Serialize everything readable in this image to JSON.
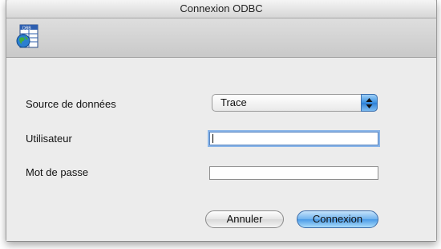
{
  "window": {
    "title": "Connexion ODBC"
  },
  "toolbar": {
    "icon": "database-globe-icon"
  },
  "form": {
    "source_label": "Source de données",
    "source_value": "Trace",
    "user_label": "Utilisateur",
    "user_value": "",
    "password_label": "Mot de passe",
    "password_value": ""
  },
  "buttons": {
    "cancel_label": "Annuler",
    "connect_label": "Connexion"
  },
  "colors": {
    "accent": "#4a9ae6",
    "background": "#ececec"
  }
}
